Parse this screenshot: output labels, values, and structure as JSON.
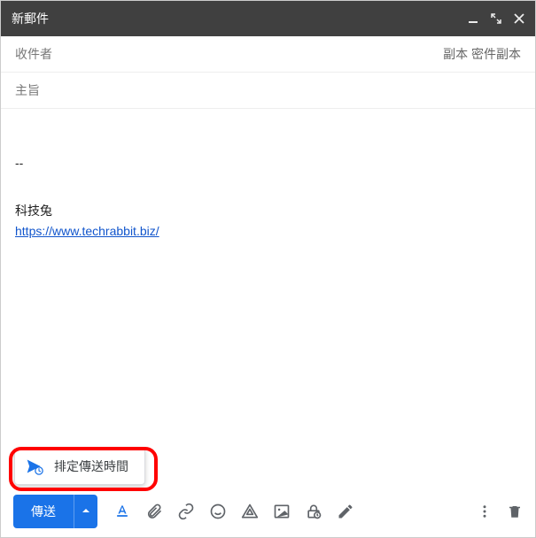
{
  "header": {
    "title": "新郵件"
  },
  "recipients": {
    "label": "收件者",
    "cc": "副本",
    "bcc": "密件副本"
  },
  "subject": {
    "placeholder": "主旨"
  },
  "body": {
    "separator": "--",
    "signature_name": "科技兔",
    "signature_url": "https://www.techrabbit.biz/"
  },
  "schedule": {
    "label": "排定傳送時間"
  },
  "toolbar": {
    "send_label": "傳送"
  }
}
